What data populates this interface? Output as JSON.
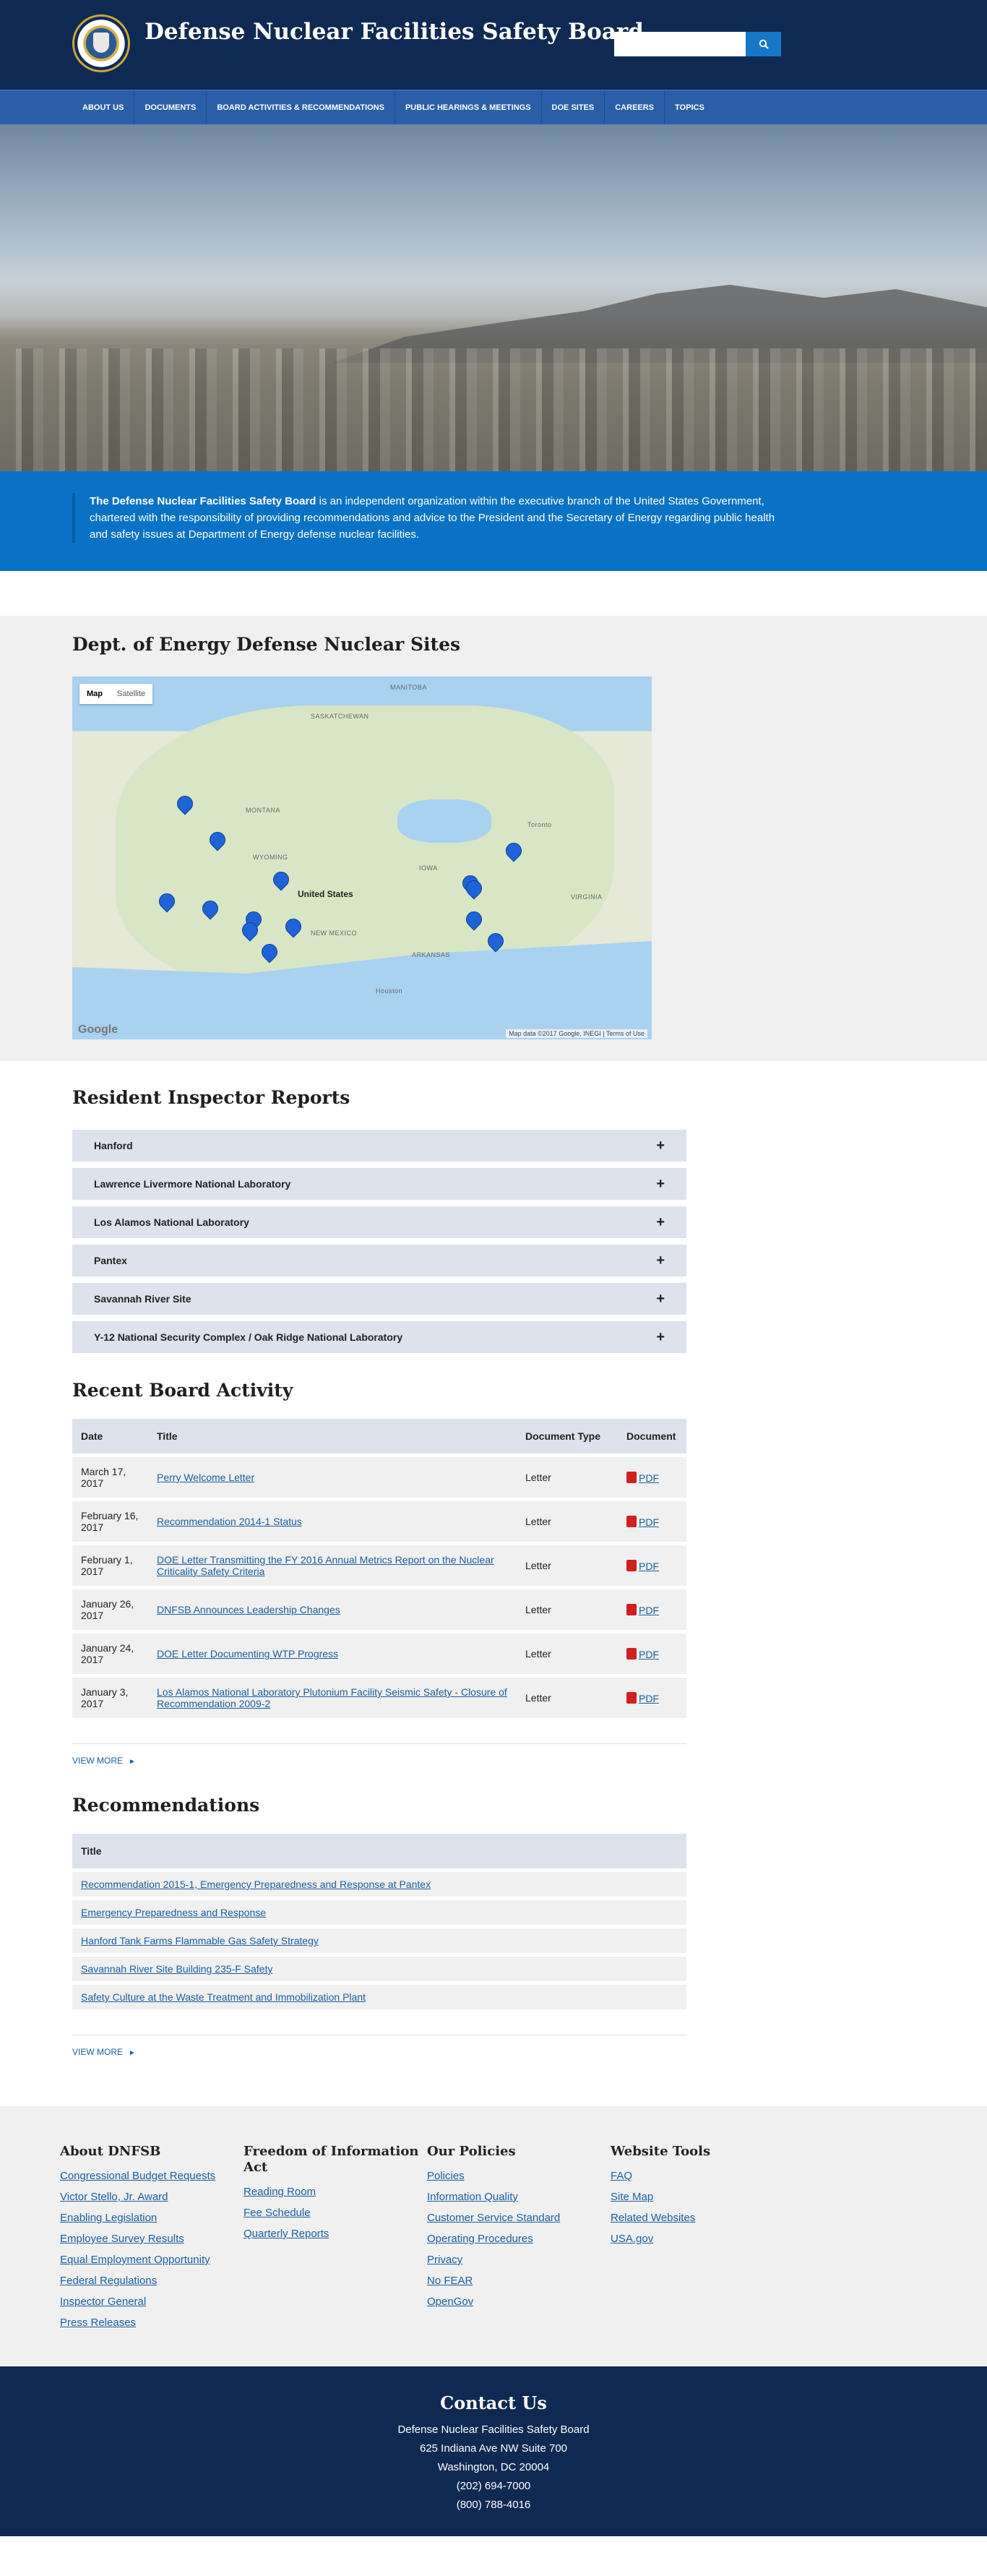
{
  "header": {
    "title": "Defense Nuclear Facilities Safety Board",
    "search_placeholder": ""
  },
  "nav": [
    "About Us",
    "Documents",
    "Board Activities & Recommendations",
    "Public Hearings & Meetings",
    "DOE Sites",
    "Careers",
    "Topics"
  ],
  "intro": {
    "bold": "The Defense Nuclear Facilities Safety Board",
    "rest": " is an independent organization within the executive branch of the United States Government, chartered with the responsibility of providing recommendations and advice to the President and the Secretary of Energy regarding public health and safety issues at Department of Energy defense nuclear facilities."
  },
  "map": {
    "heading": "Dept. of Energy Defense Nuclear Sites",
    "tab_map": "Map",
    "tab_satellite": "Satellite",
    "country_label": "United States",
    "attribution": "Map data ©2017 Google, INEGI | Terms of Use",
    "google": "Google"
  },
  "inspector": {
    "heading": "Resident Inspector Reports",
    "items": [
      "Hanford",
      "Lawrence Livermore National Laboratory",
      "Los Alamos National Laboratory",
      "Pantex",
      "Savannah River Site",
      "Y-12 National Security Complex / Oak Ridge National Laboratory"
    ],
    "toggle": "+"
  },
  "activity": {
    "heading": "Recent Board Activity",
    "columns": [
      "Date",
      "Title",
      "Document Type",
      "Document"
    ],
    "rows": [
      {
        "date": "March 17, 2017",
        "title": "Perry Welcome Letter",
        "type": "Letter",
        "doc": "PDF"
      },
      {
        "date": "February 16, 2017",
        "title": "Recommendation 2014-1 Status",
        "type": "Letter",
        "doc": "PDF"
      },
      {
        "date": "February 1, 2017",
        "title": "DOE Letter Transmitting the FY 2016 Annual Metrics Report on the Nuclear Criticality Safety Criteria",
        "type": "Letter",
        "doc": "PDF"
      },
      {
        "date": "January 26, 2017",
        "title": "DNFSB Announces Leadership Changes",
        "type": "Letter",
        "doc": "PDF"
      },
      {
        "date": "January 24, 2017",
        "title": "DOE Letter Documenting WTP Progress",
        "type": "Letter",
        "doc": "PDF"
      },
      {
        "date": "January 3, 2017",
        "title": "Los Alamos National Laboratory Plutonium Facility Seismic Safety - Closure of Recommendation 2009-2",
        "type": "Letter",
        "doc": "PDF"
      }
    ],
    "view_more": "VIEW MORE"
  },
  "recommendations": {
    "heading": "Recommendations",
    "column": "Title",
    "rows": [
      "Recommendation 2015-1, Emergency Preparedness and Response at Pantex",
      "Emergency Preparedness and Response",
      "Hanford Tank Farms Flammable Gas Safety Strategy",
      "Savannah River Site Building 235-F Safety",
      "Safety Culture at the Waste Treatment and Immobilization Plant"
    ],
    "view_more": "VIEW MORE"
  },
  "footer": {
    "columns": [
      {
        "heading": "About DNFSB",
        "links": [
          "Congressional Budget Requests",
          "Victor Stello, Jr. Award",
          "Enabling Legislation",
          "Employee Survey Results",
          "Equal Employment Opportunity",
          "Federal Regulations",
          "Inspector General",
          "Press Releases"
        ]
      },
      {
        "heading": "Freedom of Information Act",
        "links": [
          "Reading Room",
          "Fee Schedule",
          "Quarterly Reports"
        ]
      },
      {
        "heading": "Our Policies",
        "links": [
          "Policies",
          "Information Quality",
          "Customer Service Standard",
          "Operating Procedures",
          "Privacy",
          "No FEAR",
          "OpenGov"
        ]
      },
      {
        "heading": "Website Tools",
        "links": [
          "FAQ",
          "Site Map",
          "Related Websites",
          "USA.gov"
        ]
      }
    ]
  },
  "contact": {
    "heading": "Contact Us",
    "lines": [
      "Defense Nuclear Facilities Safety Board",
      "625 Indiana Ave NW Suite 700",
      "Washington, DC 20004",
      "(202) 694-7000",
      "(800) 788-4016"
    ]
  }
}
